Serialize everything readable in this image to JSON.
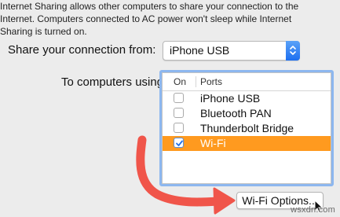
{
  "description": {
    "lines": [
      "Internet Sharing allows other computers to share your connection to the",
      "Internet. Computers connected to AC power won't sleep while Internet",
      "Sharing is turned on."
    ]
  },
  "share_from": {
    "label": "Share your connection from:",
    "selected": "iPhone USB"
  },
  "to_computers": {
    "label": "To computers using:",
    "columns": {
      "on": "On",
      "ports": "Ports"
    },
    "ports": [
      {
        "name": "iPhone USB",
        "checked": false,
        "selected": false
      },
      {
        "name": "Bluetooth PAN",
        "checked": false,
        "selected": false
      },
      {
        "name": "Thunderbolt Bridge",
        "checked": false,
        "selected": false
      },
      {
        "name": "Wi-Fi",
        "checked": true,
        "selected": true
      }
    ]
  },
  "wifi_options_button": {
    "label": "Wi-Fi Options..."
  },
  "watermark": "wsxdn.com",
  "colors": {
    "selection": "#ff9a1f",
    "arrow": "#f0554a",
    "focus_ring": "#8db7ef",
    "stepper": "#1d6ff0"
  }
}
